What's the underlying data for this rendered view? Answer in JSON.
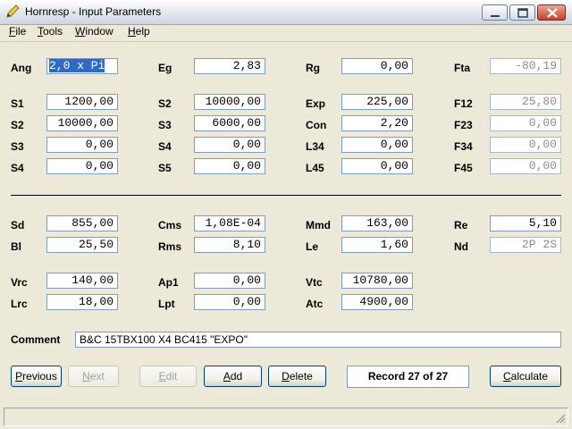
{
  "window": {
    "title": "Hornresp - Input Parameters",
    "icon": "pencil-icon"
  },
  "menu": [
    {
      "key": "F",
      "rest": "ile"
    },
    {
      "key": "T",
      "rest": "ools"
    },
    {
      "key": "W",
      "rest": "indow"
    },
    {
      "key": "H",
      "rest": "elp"
    }
  ],
  "params": {
    "Ang": {
      "label": "Ang",
      "value": "2,0 x Pi"
    },
    "Eg": {
      "label": "Eg",
      "value": "2,83"
    },
    "Rg": {
      "label": "Rg",
      "value": "0,00"
    },
    "Fta": {
      "label": "Fta",
      "value": "-80,19"
    },
    "S1": {
      "label": "S1",
      "value": "1200,00"
    },
    "S2a": {
      "label": "S2",
      "value": "10000,00"
    },
    "Exp": {
      "label": "Exp",
      "value": "225,00"
    },
    "F12": {
      "label": "F12",
      "value": "25,80"
    },
    "S2b": {
      "label": "S2",
      "value": "10000,00"
    },
    "S3a": {
      "label": "S3",
      "value": "6000,00"
    },
    "Con": {
      "label": "Con",
      "value": "2,20"
    },
    "F23": {
      "label": "F23",
      "value": "0,00"
    },
    "S3b": {
      "label": "S3",
      "value": "0,00"
    },
    "S4a": {
      "label": "S4",
      "value": "0,00"
    },
    "L34": {
      "label": "L34",
      "value": "0,00"
    },
    "F34": {
      "label": "F34",
      "value": "0,00"
    },
    "S4b": {
      "label": "S4",
      "value": "0,00"
    },
    "S5": {
      "label": "S5",
      "value": "0,00"
    },
    "L45": {
      "label": "L45",
      "value": "0,00"
    },
    "F45": {
      "label": "F45",
      "value": "0,00"
    },
    "Sd": {
      "label": "Sd",
      "value": "855,00"
    },
    "Cms": {
      "label": "Cms",
      "value": "1,08E-04"
    },
    "Mmd": {
      "label": "Mmd",
      "value": "163,00"
    },
    "Re": {
      "label": "Re",
      "value": "5,10"
    },
    "Bl": {
      "label": "Bl",
      "value": "25,50"
    },
    "Rms": {
      "label": "Rms",
      "value": "8,10"
    },
    "Le": {
      "label": "Le",
      "value": "1,60"
    },
    "Nd": {
      "label": "Nd",
      "value": "2P 2S"
    },
    "Vrc": {
      "label": "Vrc",
      "value": "140,00"
    },
    "Ap1": {
      "label": "Ap1",
      "value": "0,00"
    },
    "Vtc": {
      "label": "Vtc",
      "value": "10780,00"
    },
    "Lrc": {
      "label": "Lrc",
      "value": "18,00"
    },
    "Lpt": {
      "label": "Lpt",
      "value": "0,00"
    },
    "Atc": {
      "label": "Atc",
      "value": "4900,00"
    }
  },
  "comment": {
    "label": "Comment",
    "value": "B&C 15TBX100 X4 BC415 \"EXPO\""
  },
  "buttons": {
    "previous": {
      "key": "P",
      "rest": "revious"
    },
    "next": {
      "key": "N",
      "rest": "ext"
    },
    "edit": {
      "key": "E",
      "rest": "dit"
    },
    "add": {
      "key": "A",
      "rest": "dd"
    },
    "delete": {
      "key": "D",
      "rest": "elete"
    },
    "calculate": {
      "key": "C",
      "rest": "alculate"
    }
  },
  "record": "Record 27 of 27",
  "colors": {
    "selection": "#316AC5",
    "readonly_text": "#8C8C8C",
    "face": "#ECE9D8"
  }
}
